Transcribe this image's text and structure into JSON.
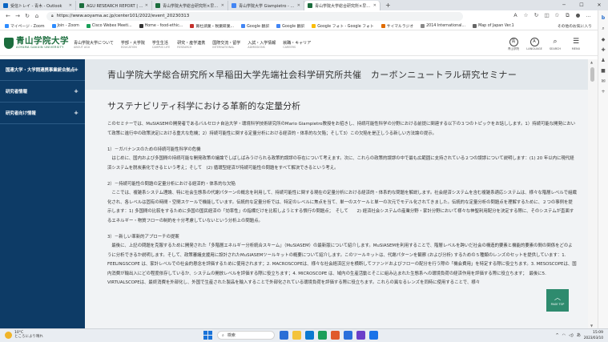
{
  "browser": {
    "tabs": [
      {
        "title": "受信トレイ - 青木 - Outlook",
        "color": "#0a64c2"
      },
      {
        "title": "AGU RESEARCH REPORT | 青山学院",
        "color": "#1b6d3d"
      },
      {
        "title": "青山学院大学総合研究所×早稲田",
        "color": "#1b6d3d"
      },
      {
        "title": "青山学院大学 Giampietro - 検索",
        "color": "#4285f4"
      },
      {
        "title": "青山学院大学総合研究所×早稲田",
        "color": "#1b6d3d",
        "active": true
      }
    ],
    "new_tab": "+",
    "url": "https://www.aoyama.ac.jp/center101/2022/event_20230313",
    "bookmarks": [
      {
        "label": "マイページ - Zoom",
        "color": "#2d8cff"
      },
      {
        "label": "Join - Zoom",
        "color": "#2d8cff"
      },
      {
        "label": "Cisco Webex Meeti...",
        "color": "#1aa059"
      },
      {
        "label": "Home - food-ethic...",
        "color": "#333333"
      },
      {
        "label": "賞杜請業・税業研業...",
        "color": "#c4302b"
      },
      {
        "label": "Google 翻訳",
        "color": "#4285f4"
      },
      {
        "label": "Google 翻訳",
        "color": "#4285f4"
      },
      {
        "label": "Google フォト - Google フォト",
        "color": "#fbbc05"
      },
      {
        "label": "サイマルラジオ",
        "color": "#e06c00"
      },
      {
        "label": "2014 International...",
        "color": "#888888"
      },
      {
        "label": "Map of Japan Ver.1",
        "color": "#666666"
      }
    ],
    "bookmarks_right": "その他のお気に入り"
  },
  "site": {
    "logo_jp": "青山学院大学",
    "logo_en": "AOYAMA GAKUIN UNIVERSITY",
    "nav": [
      {
        "jp": "青山学院大学について",
        "en": "ABOUT AGU"
      },
      {
        "jp": "学部・大学院",
        "en": "EDUCATION"
      },
      {
        "jp": "学生生活",
        "en": "CAMPUS LIFE"
      },
      {
        "jp": "研究・産学連携",
        "en": "RESEARCH"
      },
      {
        "jp": "国際交流・留学",
        "en": "INTERNATIONAL"
      },
      {
        "jp": "入試・入学情報",
        "en": "ADMISSIONS"
      },
      {
        "jp": "就職・キャリア",
        "en": "CAREERS"
      }
    ],
    "header_buttons": [
      {
        "icon": "青",
        "label": "青山学院"
      },
      {
        "icon": "A",
        "label": "LANGUAGE"
      },
      {
        "icon": "⌕",
        "label": "SEARCH"
      },
      {
        "icon": "☰",
        "label": "MENU"
      }
    ]
  },
  "sidebar": {
    "items": [
      {
        "label": "国連大学・大学間連携事業統合拠点"
      },
      {
        "label": "研究者情報"
      },
      {
        "label": "研究者向け情報"
      }
    ]
  },
  "page": {
    "title": "青山学院大学総合研究所×早稲田大学先端社会科学研究所共催　カーボンニュートラル研究セミナー",
    "heading": "サステナビリティ科学における革新的な定量分析",
    "paragraphs": [
      "このセミナーでは、MuSIASEMの開発者であるバルセロナ自治大学・環境科学技術研究所のMario Giampietro教授をお招きし、持続可能性科学の分野における前提に関連する以下の３つのトピックをお話しします。1）持続可能な開発において政策に進行中の政策決定における重大な危機；2）持続可能性に関する定量分析における経済的・体系的な欠陥；そして3）この欠陥を是正しうる新しい方法論の提示。",
      "1）－ガバナンスのための持続可能性科学の危機\n　はじめに、国内および多国間の持続可能な開発政策の議論でしばしばみうけられる政策的誤謬の存在について考えます。次に、これらの政策的誤謬の中で最も広範囲に支持されている２つの誤謬について説明します：(1) 20 年以内に現代経済システムを脱炭素化できるという考え；そして　(2) 循環型経済が持続可能性の問題をすべて解決できるという考え。",
      "2）－持続可能性の問題の定量分析における経済的・体系的な欠陥\n　ここでは、複雑系システム理論、特に社会生態系の代謝パターンの概念を利用して、持続可能性に関する現在の定量分析における経済的・体系的な問題を解説します。社会経済システムを含む複雑系適応システムは、様々な階層レベルで組織化され、各レベルは固有の時間・空間スケールで機能しています。伝統的な定量分析では、特定のレベルに焦点を当て、単一のスケールと単一の次元でモデル化されてきました。伝統的な定量分析の問題点を理解するために、２つの事例を提示します：1) 多国間の比較をするために多国の国民経済の「効率性」の指標だけを比較しようとする慣行の問題点；　そして　　2) 経済社会システムの産業分野・家計分野において様々な神聖利用配分を決定する際に、そのシステムが直面するエネルギー・物質フローの制約を十分考慮していないという分析上の問題点。",
      "3）－新しい革新的アプローチの提案\n　最後に、上記の問題を克服するために開発された「多階層エネルギー分析統合スキーム」（MuSIASEM）の最新版について紹介します。MuSIASEMを利用することで、階層レベルを跨いだ社会の構造的要素と機能的要素の間の関係をどのように分析できるか説明します。そして、政策審議支援用に設計されたMuSIASEMツールキットの概要について紹介します。このツールキットは、代謝パターンを観察 (および分析) するための５種類のレンズのセットを提供しています：1. FEELINGSCOPE は、家計レベルでの社会的懸念を評価するために使用されます；2. MACROSCOPEは、様々な社会経済区分を横断してファンドおよびフローの配分を行う際の「機会費用」を特定する際に役立ちます。3. MESOSCOPEは、国内消費が輸出入にどの程度依存しているか、システムの開放レベルを評価する際に役立ちます；4. MICROSCOPE は、域内の生産活動とそこに組み込まれた生態系への環境負荷の経済作用を評価する際に役立ちます；　最後に5. VIRTUALSCOPEは、最終消費を外部化し、外国で生産された製品を輸入することで外部化されている環境負荷を評価する際に役立ちます。これらの異なるレンズを同時に使用することで、様々"
    ],
    "pagetop_label": "PAGE TOP"
  },
  "taskbar": {
    "temp": "10°C",
    "weather": "ところにより晴れ",
    "search_label": "検索",
    "apps": [
      "#2b6fd6",
      "#f3c33c",
      "#0b79d0",
      "#1b9e5a",
      "#e05a2b",
      "#2a6fdb",
      "#6b3fc9",
      "#1a73e8"
    ],
    "time": "15:09",
    "date": "2023/03/10",
    "ime": "あ"
  }
}
